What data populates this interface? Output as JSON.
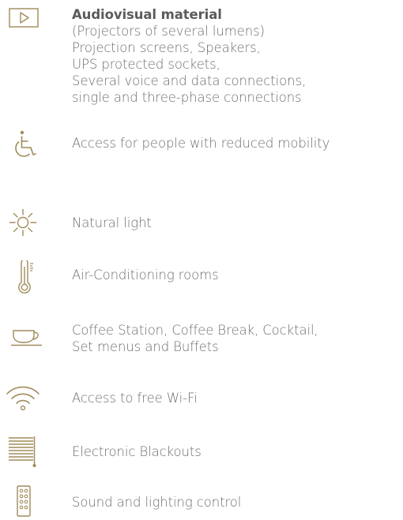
{
  "accent_color": "#a08b5c",
  "text_color": "#6d6e70",
  "features": [
    {
      "icon": "play-icon",
      "title": "Audiovisual material",
      "lines": [
        "(Projectors of several lumens)",
        "Projection screens, Speakers,",
        "UPS protected sockets,",
        "Several voice and data connections,",
        "single and three-phase connections"
      ]
    },
    {
      "icon": "wheelchair-icon",
      "lines": [
        "Access for people with reduced mobility"
      ]
    },
    {
      "icon": "sun-icon",
      "lines": [
        "Natural light"
      ]
    },
    {
      "icon": "thermometer-icon",
      "lines": [
        "Air-Conditioning rooms"
      ]
    },
    {
      "icon": "coffee-cup-icon",
      "lines": [
        "Coffee Station, Coffee Break, Cocktail,",
        "Set menus and Buffets"
      ]
    },
    {
      "icon": "wifi-icon",
      "lines": [
        "Access to free Wi-Fi"
      ]
    },
    {
      "icon": "blinds-icon",
      "lines": [
        "Electronic Blackouts"
      ]
    },
    {
      "icon": "remote-control-icon",
      "lines": [
        "Sound and lighting control"
      ]
    }
  ]
}
